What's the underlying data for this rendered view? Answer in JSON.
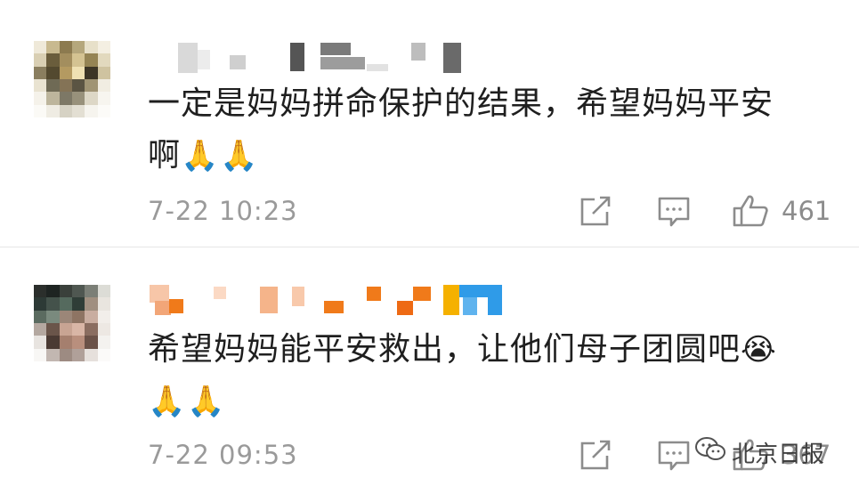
{
  "comments": [
    {
      "text": "一定是妈妈拼命保护的结果，希望妈妈平安\n啊",
      "emoji": "🙏🙏",
      "time": "7-22 10:23",
      "likes": "461"
    },
    {
      "text": "希望妈妈能平安救出，让他们母子团圆吧",
      "emoji_inline": "😭",
      "emoji": "🙏🙏",
      "time": "7-22 09:53",
      "likes": "367"
    }
  ],
  "watermark": {
    "text": "北京日报"
  },
  "icons": {
    "share": "share-icon",
    "reply": "comment-icon",
    "like": "thumbs-up-icon",
    "wechat": "wechat-icon"
  },
  "colors": {
    "text": "#1f1f1f",
    "meta": "#9a9a9a",
    "orange": "#f07a1a",
    "blue": "#2f9be8"
  }
}
